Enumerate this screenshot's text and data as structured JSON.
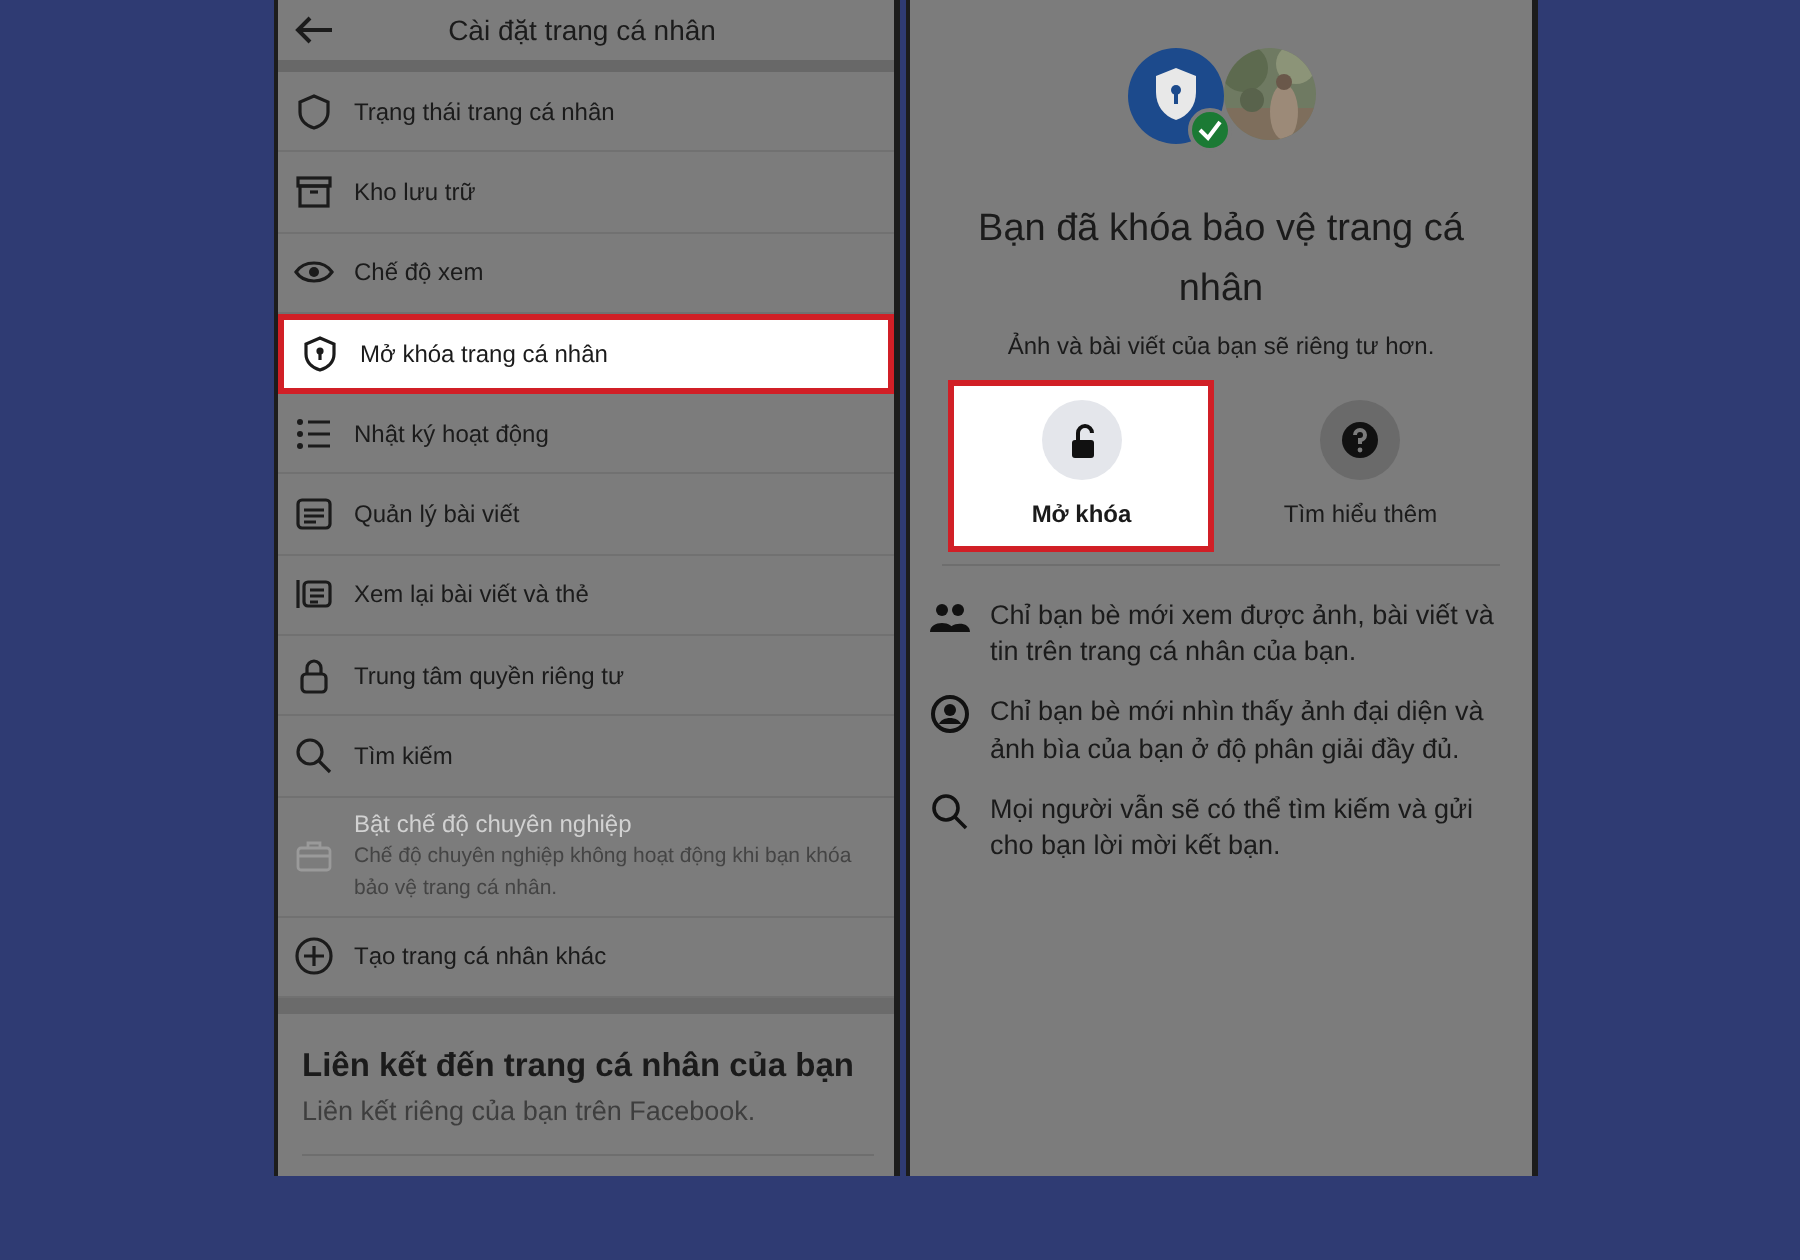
{
  "settings_screen": {
    "title": "Cài đặt trang cá nhân",
    "items": [
      {
        "label": "Trạng thái trang cá nhân",
        "selected": false,
        "disabled": false
      },
      {
        "label": "Kho lưu trữ",
        "selected": false,
        "disabled": false
      },
      {
        "label": "Chế độ xem",
        "selected": false,
        "disabled": false
      },
      {
        "label": "Mở khóa trang cá nhân",
        "selected": true,
        "disabled": false
      },
      {
        "label": "Nhật ký hoạt động",
        "selected": false,
        "disabled": false
      },
      {
        "label": "Quản lý bài viết",
        "selected": false,
        "disabled": false
      },
      {
        "label": "Xem lại bài viết và thẻ",
        "selected": false,
        "disabled": false
      },
      {
        "label": "Trung tâm quyền riêng tư",
        "selected": false,
        "disabled": false
      },
      {
        "label": "Tìm kiếm",
        "selected": false,
        "disabled": false
      },
      {
        "label": "Bật chế độ chuyên nghiệp",
        "description": "Chế độ chuyên nghiệp không hoạt động khi bạn khóa bảo vệ trang cá nhân.",
        "selected": false,
        "disabled": true
      },
      {
        "label": "Tạo trang cá nhân khác",
        "selected": false,
        "disabled": false
      }
    ],
    "section": {
      "title": "Liên kết đến trang cá nhân của bạn",
      "subtitle": "Liên kết riêng của bạn trên Facebook."
    }
  },
  "lock_screen": {
    "title": "Bạn đã khóa bảo vệ trang cá nhân",
    "subtitle": "Ảnh và bài viết của bạn sẽ riêng tư hơn.",
    "actions": [
      {
        "label": "Mở khóa",
        "selected": true
      },
      {
        "label": "Tìm hiểu thêm",
        "selected": false
      }
    ],
    "bullets": [
      "Chỉ bạn bè mới xem được ảnh, bài viết và tin trên trang cá nhân của bạn.",
      "Chỉ bạn bè mới nhìn thấy ảnh đại diện và ảnh bìa của bạn ở độ phân giải đầy đủ.",
      "Mọi người vẫn sẽ có thể tìm kiếm và gửi cho bạn lời mời kết bạn."
    ]
  }
}
